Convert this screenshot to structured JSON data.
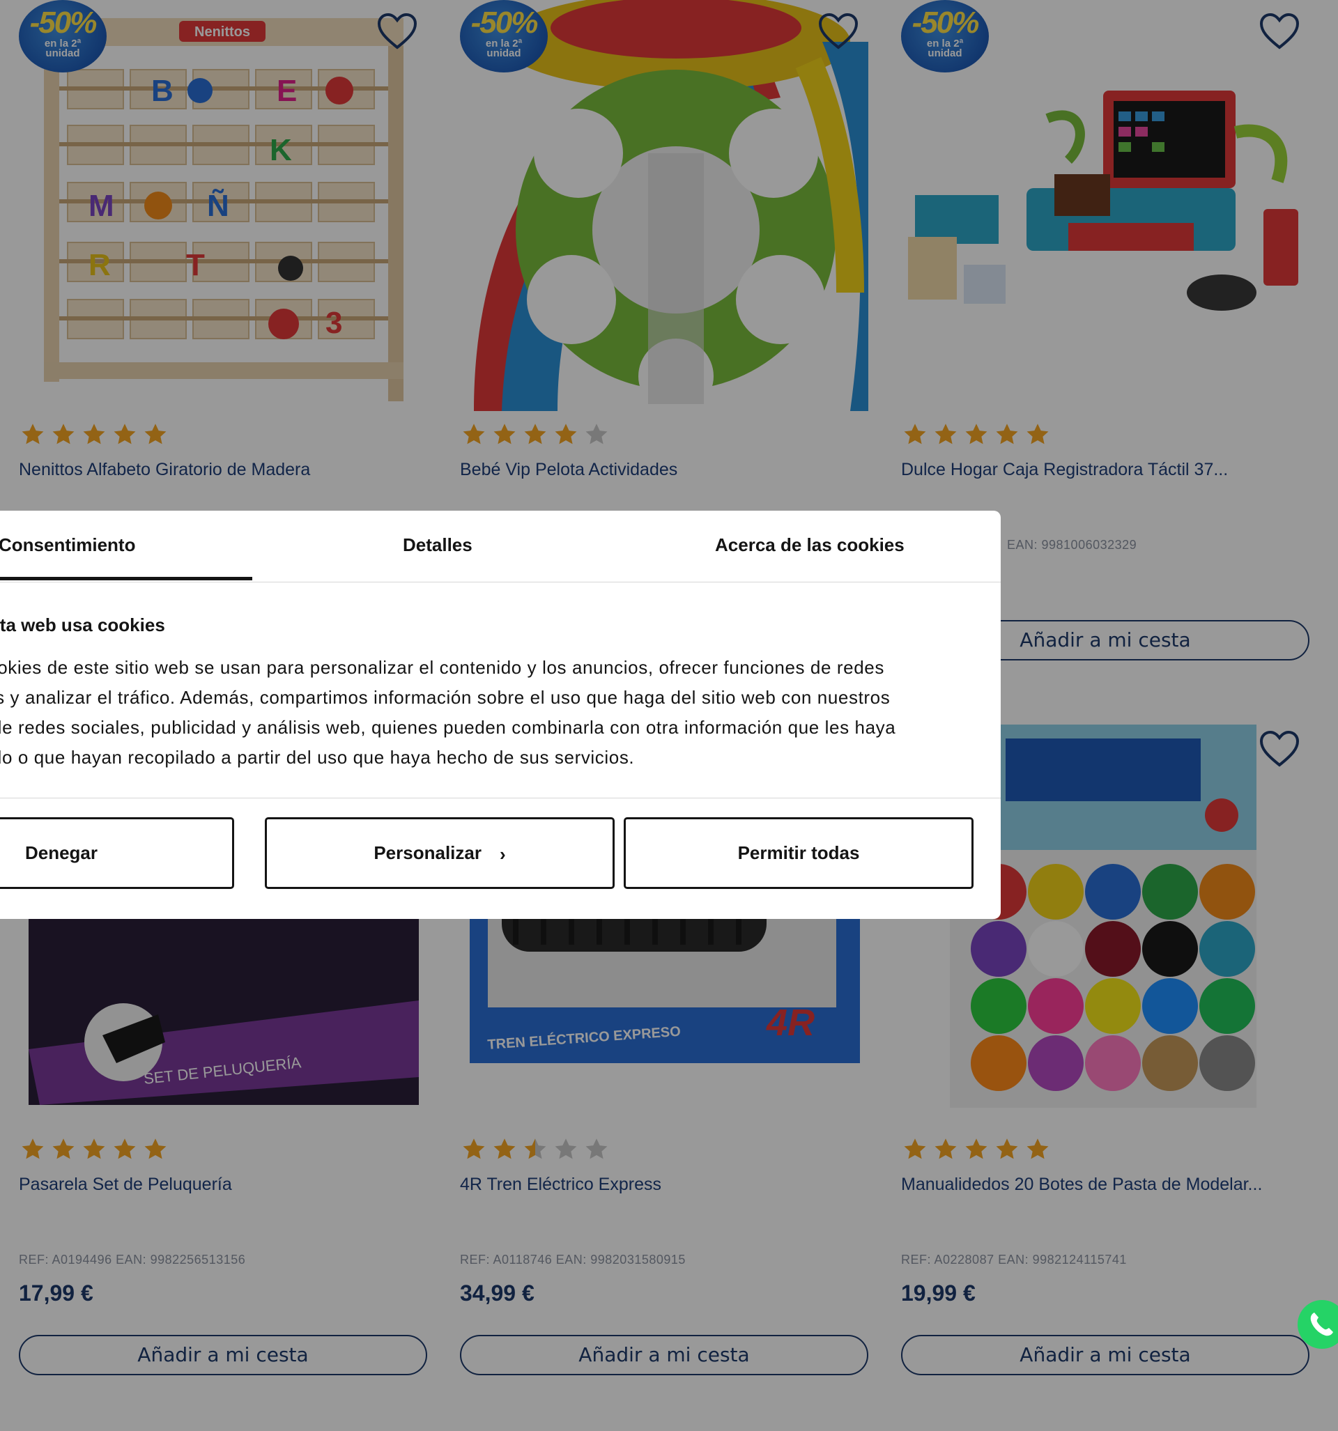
{
  "products": [
    {
      "name": "Nenittos Alfabeto Giratorio de Madera",
      "badge": {
        "discount": "-50%",
        "line1": "en la 2ª",
        "line2": "unidad"
      },
      "rating_stars": 5,
      "ref": "",
      "price": "",
      "cart_label": ""
    },
    {
      "name": "Bebé Vip Pelota Actividades",
      "badge": {
        "discount": "-50%",
        "line1": "en la 2ª",
        "line2": "unidad"
      },
      "rating_stars": 4,
      "ref": "",
      "price": "",
      "cart_label": ""
    },
    {
      "name": "Dulce Hogar Caja Registradora Táctil 37...",
      "badge": {
        "discount": "-50%",
        "line1": "en la 2ª",
        "line2": "unidad"
      },
      "rating_stars": 5,
      "ref": "EAN: 9981006032329",
      "price": "",
      "cart_label": "Añadir a mi cesta"
    },
    {
      "name": "Pasarela Set de Peluquería",
      "rating_stars": 5,
      "ref": "REF: A0194496 EAN: 9982256513156",
      "price": "17,99 €",
      "cart_label": "Añadir a mi cesta"
    },
    {
      "name": "4R Tren Eléctrico Express",
      "rating_stars": 2.5,
      "ref": "REF: A0118746 EAN: 9982031580915",
      "price": "34,99 €",
      "cart_label": "Añadir a mi cesta"
    },
    {
      "name": "Manualidedos 20 Botes de Pasta de Modelar...",
      "rating_stars": 5,
      "ref": "REF: A0228087 EAN: 9982124115741",
      "price": "19,99 €",
      "cart_label": "Añadir a mi cesta"
    }
  ],
  "cookie_dialog": {
    "tabs": [
      "Consentimiento",
      "Detalles",
      "Acerca de las cookies"
    ],
    "active_tab": "Consentimiento",
    "title": "Esta web usa cookies",
    "body_lines": [
      "Las cookies de este sitio web se usan para personalizar el contenido y los anuncios, ofrecer funciones de redes",
      "sociales y analizar el tráfico. Además, compartimos información sobre el uso que haga del sitio web con nuestros",
      "partners de redes sociales, publicidad y análisis web, quienes pueden combinarla con otra información que les haya",
      "proporcionado o que hayan recopilado a partir del uso que haya hecho de sus servicios."
    ],
    "buttons": {
      "deny": "Denegar",
      "customize": "Personalizar",
      "allow_all": "Permitir todas"
    }
  },
  "brand_label": "Nenittos",
  "colors": {
    "navy": "#1d3a6b",
    "star": "#f5a623",
    "star_empty": "#c9c9c9",
    "whatsapp": "#25d366"
  }
}
